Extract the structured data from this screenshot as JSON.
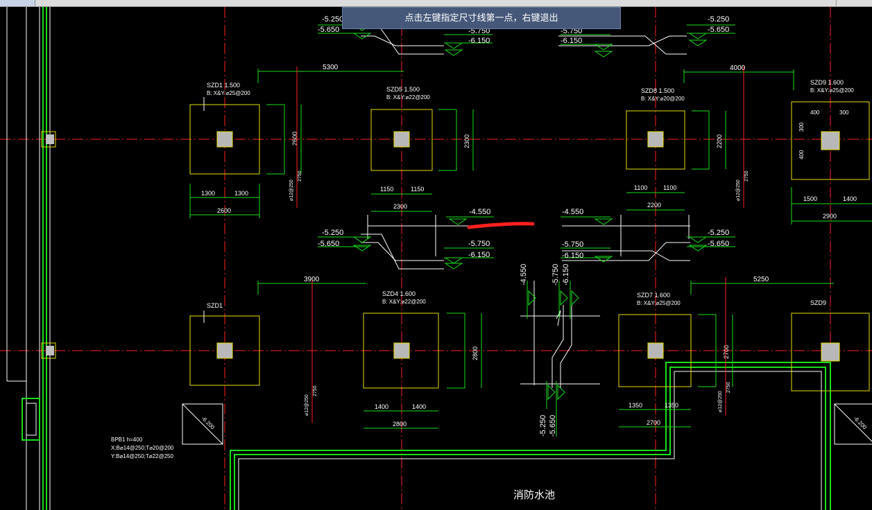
{
  "prompt_text": "点击左键指定尺寸线第一点，右键退出",
  "pool_label": "消防水池",
  "note_lines": [
    "BPB1 h=400",
    "X:B⌀14@250;T⌀20@200",
    "Y:B⌀14@250;T⌀22@250"
  ],
  "colors": {
    "grid": "#ff2020",
    "outline": "#e8e000",
    "dim": "#19e019",
    "wall": "#19e019",
    "text": "#ffffff",
    "mark": "#ff1f1f",
    "background": "#000000"
  },
  "footings": [
    {
      "id": "szd1",
      "name": "SZD1 1.500",
      "spec": "B: X&Y:⌀25@200",
      "dim_a": "1300",
      "dim_b": "1300",
      "total_h": "2600",
      "total_w": "2600"
    },
    {
      "id": "szd5",
      "name": "SZD5 1.500",
      "spec": "B: X&Y:⌀22@200",
      "dim_a": "1150",
      "dim_b": "1150",
      "total_h": "2300",
      "total_w": "2300"
    },
    {
      "id": "szd8",
      "name": "SZD8 1.500",
      "spec": "B: X&Y:⌀20@200",
      "dim_a": "1100",
      "dim_b": "1100",
      "total_h": "2200",
      "total_w": "2200"
    },
    {
      "id": "szd9",
      "name": "SZD9 1.600",
      "spec": "B: X&Y:⌀25@200",
      "dim_a": "1500",
      "dim_b": "1400",
      "total_h": "",
      "total_w": "2900"
    },
    {
      "id": "szd1b",
      "name": "SZD1",
      "spec": "",
      "dim_a": "",
      "dim_b": "",
      "total_h": "",
      "total_w": ""
    },
    {
      "id": "szd4",
      "name": "SZD4 1.600",
      "spec": "B: X&Y:⌀22@200",
      "dim_a": "1400",
      "dim_b": "1400",
      "total_h": "2800",
      "total_w": "2800"
    },
    {
      "id": "szd7",
      "name": "SZD7 1.600",
      "spec": "B: X&Y:⌀25@200",
      "dim_a": "1350",
      "dim_b": "1350",
      "total_h": "2700",
      "total_w": "2700"
    },
    {
      "id": "szd9b",
      "name": "SZD9",
      "spec": "",
      "dim_a": "",
      "dim_b": "",
      "total_h": "",
      "total_w": ""
    }
  ],
  "col_small_dims": [
    "400",
    "300",
    "300",
    "400"
  ],
  "spans": [
    "5300",
    "4000",
    "3900",
    "5250"
  ],
  "rebar_notes": [
    "⌀12@250",
    "2750"
  ],
  "elevations": {
    "e1": "-5.250",
    "e2": "-5.650",
    "e3": "-5.750",
    "e4": "-6.150",
    "e5": "-4.550",
    "v1": "-4.550",
    "v2": "-5.750",
    "v3": "-6.150",
    "v4": "-5.250",
    "v5": "-5.650"
  },
  "box_label": "-6.200"
}
